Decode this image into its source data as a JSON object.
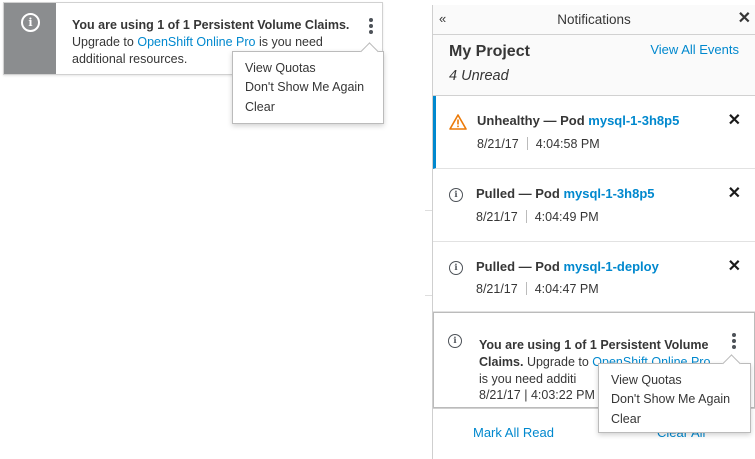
{
  "toast": {
    "message_bold": "You are using 1 of 1 Persistent Volume Claims.",
    "upgrade_prefix": "Upgrade to",
    "upgrade_link": "OpenShift Online Pro",
    "upgrade_suffix": "is you need additional resources.",
    "icon": "info-circle-icon"
  },
  "toast_menu": {
    "items": [
      "View Quotas",
      "Don't Show Me Again",
      "Clear"
    ]
  },
  "drawer": {
    "title": "Notifications",
    "collapse_glyph": "«",
    "close_glyph": "✕",
    "project": "My Project",
    "unread": "4 Unread",
    "view_all": "View All Events"
  },
  "notifications": [
    {
      "status": "Unhealthy",
      "dash": "—",
      "kind": "Pod",
      "name": "mysql-1-3h8p5",
      "date": "8/21/17",
      "time": "4:04:58 PM",
      "icon": "warning-triangle-icon"
    },
    {
      "status": "Pulled",
      "dash": "—",
      "kind": "Pod",
      "name": "mysql-1-3h8p5",
      "date": "8/21/17",
      "time": "4:04:49 PM",
      "icon": "info-circle-icon"
    },
    {
      "status": "Pulled",
      "dash": "—",
      "kind": "Pod",
      "name": "mysql-1-deploy",
      "date": "8/21/17",
      "time": "4:04:47 PM",
      "icon": "info-circle-icon"
    }
  ],
  "quota_notification": {
    "message_bold": "You are using 1 of 1 Persistent Volume Claims.",
    "upgrade_prefix": "Upgrade to",
    "upgrade_link": "OpenShift Online Pro",
    "upgrade_suffix": "is you need additi",
    "date": "8/21/17",
    "time": "4:03:22 PM",
    "time_sep": "|"
  },
  "quota_menu": {
    "items": [
      "View Quotas",
      "Don't Show Me Again",
      "Clear"
    ]
  },
  "footer": {
    "mark_all_read": "Mark All Read",
    "clear_all": "Clear All"
  },
  "colors": {
    "link": "#0088ce",
    "warning": "#ec7a08",
    "toast_icon_bg": "#8b8d8f"
  }
}
